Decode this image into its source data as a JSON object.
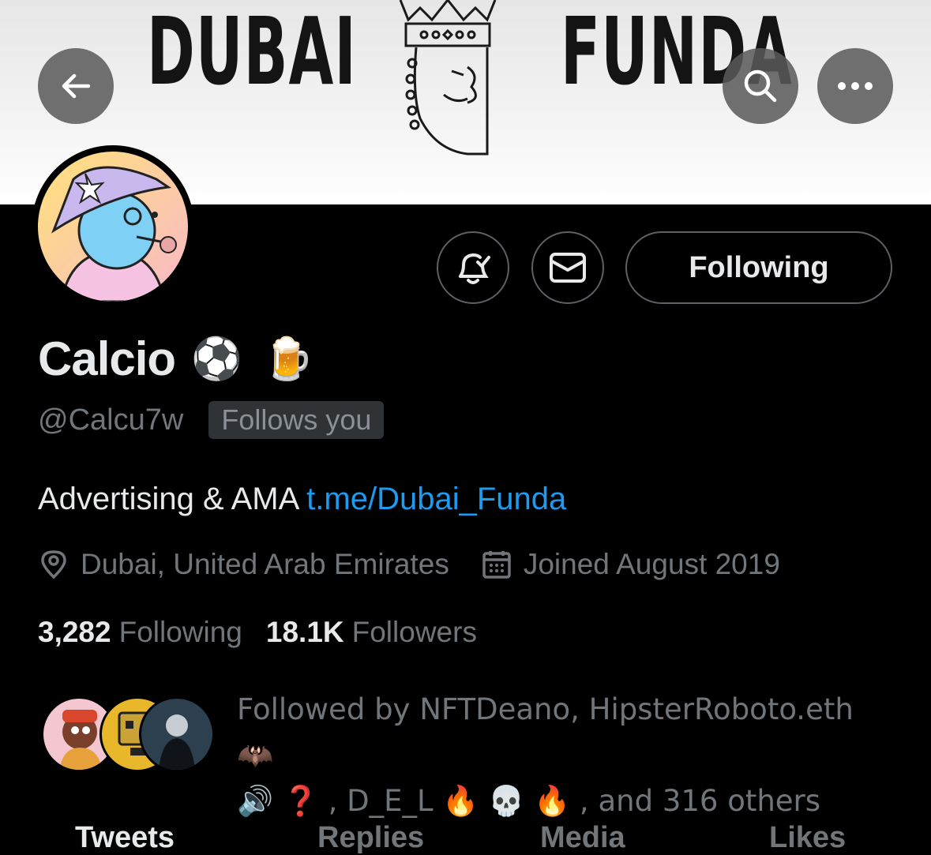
{
  "banner": {
    "word_left": "DUBAI",
    "word_right": "FUNDA",
    "background_color": "#f0f0f0"
  },
  "nav": {
    "back_icon": "arrow-left-icon",
    "search_icon": "search-icon",
    "more_icon": "more-horizontal-icon"
  },
  "actions": {
    "notifications_icon": "bell-check-icon",
    "message_icon": "envelope-icon",
    "following_label": "Following"
  },
  "profile": {
    "name": "Calcio",
    "name_emojis": [
      "⚽",
      "🍺"
    ],
    "handle": "@Calcu7w",
    "follows_you": "Follows you",
    "bio_text": "Advertising & AMA ",
    "bio_link": "t.me/Dubai_Funda",
    "location": "Dubai, United Arab Emirates",
    "joined": "Joined August 2019",
    "following_count": "3,282",
    "following_label": "Following",
    "followers_count": "18.1K",
    "followers_label": "Followers"
  },
  "followed_by": {
    "line1": "Followed by NFTDeano, HipsterRoboto.eth 🦇",
    "line2": "🔊 ❓ , D_E_L 🔥 💀 🔥 , and 316 others"
  },
  "tabs": [
    "Tweets",
    "Replies",
    "Media",
    "Likes"
  ],
  "colors": {
    "accent": "#1d9bf0",
    "text_primary": "#e7e9ea",
    "text_secondary": "#71767b",
    "border": "#5c6165"
  }
}
